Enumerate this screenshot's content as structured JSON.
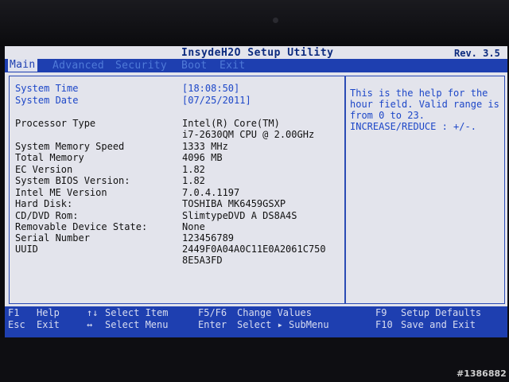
{
  "header": {
    "title": "InsydeH2O Setup Utility",
    "revision": "Rev. 3.5"
  },
  "menu": [
    {
      "label": "Main",
      "active": true
    },
    {
      "label": "Advanced",
      "active": false
    },
    {
      "label": "Security",
      "active": false
    },
    {
      "label": "Boot",
      "active": false
    },
    {
      "label": "Exit",
      "active": false
    }
  ],
  "main": {
    "system_time": {
      "label": "System Time",
      "value": "[18:08:50]"
    },
    "system_date": {
      "label": "System Date",
      "value": "[07/25/2011]"
    },
    "processor_type": {
      "label": "Processor Type",
      "value_line1": "Intel(R) Core(TM)",
      "value_line2": "i7-2630QM CPU @ 2.00GHz"
    },
    "info": [
      {
        "label": "System Memory Speed",
        "value": "1333 MHz"
      },
      {
        "label": "Total Memory",
        "value": "4096 MB"
      },
      {
        "label": "EC Version",
        "value": "1.82"
      },
      {
        "label": "System BIOS Version:",
        "value": "1.82"
      },
      {
        "label": "Intel ME Version",
        "value": "7.0.4.1197"
      },
      {
        "label": "Hard Disk:",
        "value": "TOSHIBA MK6459GSXP"
      },
      {
        "label": "CD/DVD Rom:",
        "value": "SlimtypeDVD A DS8A4S"
      },
      {
        "label": "Removable Device State:",
        "value": "None"
      },
      {
        "label": "Serial Number",
        "value": "123456789"
      },
      {
        "label": "UUID",
        "value": "2449F0A04A0C11E0A2061C750"
      }
    ],
    "uuid_line2": "8E5A3FD"
  },
  "help": {
    "text": "This is the help for the hour field. Valid range is from 0 to 23. INCREASE/REDUCE : +/-."
  },
  "footer": {
    "keys": [
      {
        "key": "F1",
        "desc": "Help"
      },
      {
        "key": "Esc",
        "desc": "Exit"
      },
      {
        "key": "↑↓",
        "desc": "Select Item"
      },
      {
        "key": "↔",
        "desc": "Select Menu"
      },
      {
        "key": "F5/F6",
        "desc": "Change Values"
      },
      {
        "key": "Enter",
        "desc": "Select ▸ SubMenu"
      },
      {
        "key": "F9",
        "desc": "Setup Defaults"
      },
      {
        "key": "F10",
        "desc": "Save and Exit"
      }
    ]
  },
  "watermark": "#1386882"
}
